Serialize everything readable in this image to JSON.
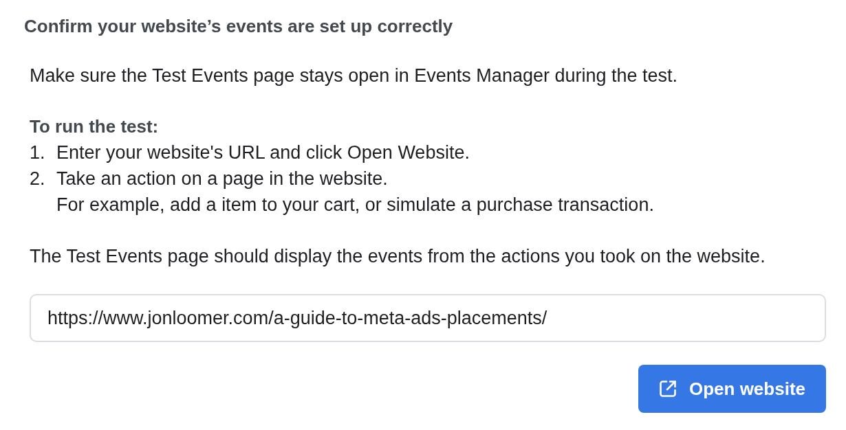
{
  "title": "Confirm your website’s events are set up correctly",
  "intro": "Make sure the Test Events page stays open in Events Manager during the test.",
  "steps_heading": "To run the test:",
  "steps": [
    {
      "number": "1.",
      "text": "Enter your website's URL and click Open Website."
    },
    {
      "number": "2.",
      "text": "Take an action on a page in the website.",
      "note": "For example, add a item to your cart, or simulate a purchase transaction."
    }
  ],
  "result_note": "The Test Events page should display the events from the actions you took on the website.",
  "url_field": {
    "value": "https://www.jonloomer.com/a-guide-to-meta-ads-placements/"
  },
  "open_button": {
    "label": "Open website"
  }
}
